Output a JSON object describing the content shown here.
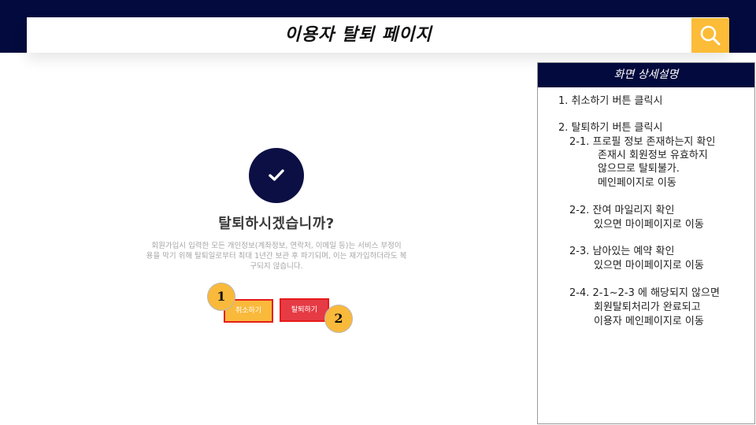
{
  "header": {
    "title": "이용자 탈퇴 페이지",
    "search_icon": "search-icon"
  },
  "dialog": {
    "icon": "check-icon",
    "title": "탈퇴하시겠습니까?",
    "description": [
      "회원가입시 입력한 모든 개인정보(계좌정보, 연락처, 이메일 등)는 서비스 부정이",
      "용을 막기 위해 탈퇴일로부터 최대 1년간 보관 후 파기되며, 이는 재가입하더라도 복",
      "구되지 않습니다."
    ],
    "cancel_label": "취소하기",
    "withdraw_label": "탈퇴하기"
  },
  "markers": [
    "1",
    "2"
  ],
  "panel": {
    "title": "화면 상세설명",
    "lines": [
      "1.       취소하기 버튼 클릭시",
      "2.       탈퇴하기 버튼 클릭시",
      "2-1.  프로필 정보 존재하는지 확인",
      "존재시 회원정보 유효하지",
      "않으므로 탈퇴불가.",
      "메인페이지로 이동",
      "2-2. 잔여 마일리지 확인",
      "있으면 마이페이지로 이동",
      "2-3. 남아있는 예약 확인",
      "있으면 마이페이지로 이동",
      "2-4. 2-1~2-3 에 해당되지 않으면",
      "회원탈퇴처리가 완료되고",
      "이용자 메인페이지로 이동"
    ]
  },
  "colors": {
    "navy": "#030a3d",
    "accent_yellow": "#fcbc38",
    "danger_red": "#e63b45"
  }
}
